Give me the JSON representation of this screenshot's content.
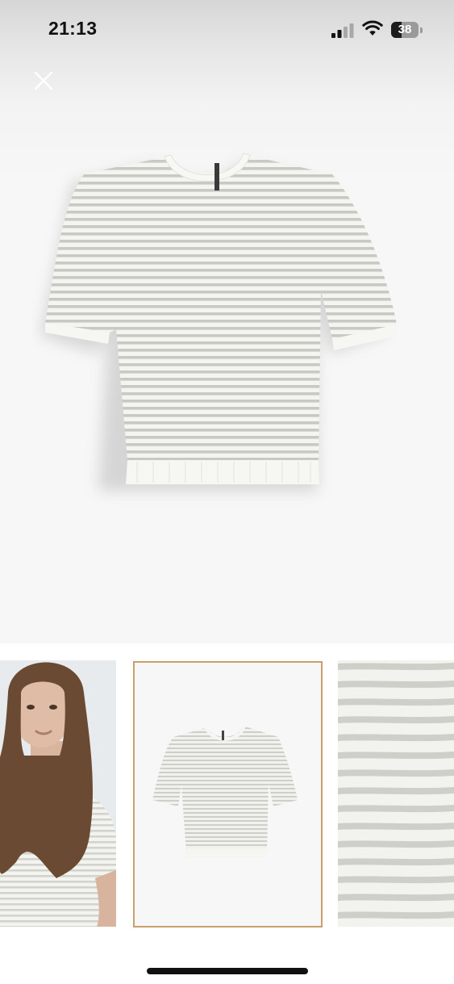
{
  "status_bar": {
    "time": "21:13",
    "battery_level": "38",
    "battery_fill_percent": 38,
    "signal_bars_active": 2,
    "icons": [
      "cellular-signal-icon",
      "wifi-icon",
      "battery-icon"
    ]
  },
  "viewer": {
    "close_icon": "close-icon",
    "main_image": "striped-short-sleeve-knit-top-product-photo"
  },
  "thumbnails": [
    {
      "name": "model-photo",
      "selected": false
    },
    {
      "name": "product-photo",
      "selected": true
    },
    {
      "name": "fabric-detail-photo",
      "selected": false
    }
  ],
  "colors": {
    "selected_border": "#c9a06b",
    "garment_base": "#f4f4f1",
    "garment_stripe": "#c9c9c4",
    "background": "#f7f7f7"
  }
}
